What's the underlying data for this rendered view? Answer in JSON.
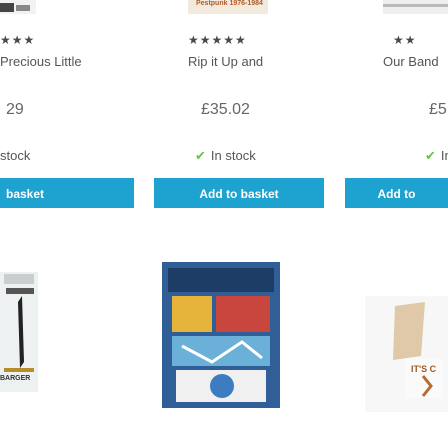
{
  "products": [
    {
      "stars": "★★★",
      "title": "Precious Little",
      "price": "29",
      "stock": "stock",
      "button": "basket",
      "cover_label": "BARGER"
    },
    {
      "top_label": "Pestpunk 1976-1984",
      "stars": "★★★★★",
      "title": "Rip it Up and",
      "price": "£35.02",
      "stock": "In stock",
      "button": "Add to basket"
    },
    {
      "stars": "★★",
      "title": "Our Band",
      "price": "£5",
      "stock": "In",
      "button": "Add to",
      "cover_label": "IT'S C"
    }
  ],
  "colors": {
    "button": "#1ea2cf",
    "stock_tick": "#6cc24a"
  }
}
